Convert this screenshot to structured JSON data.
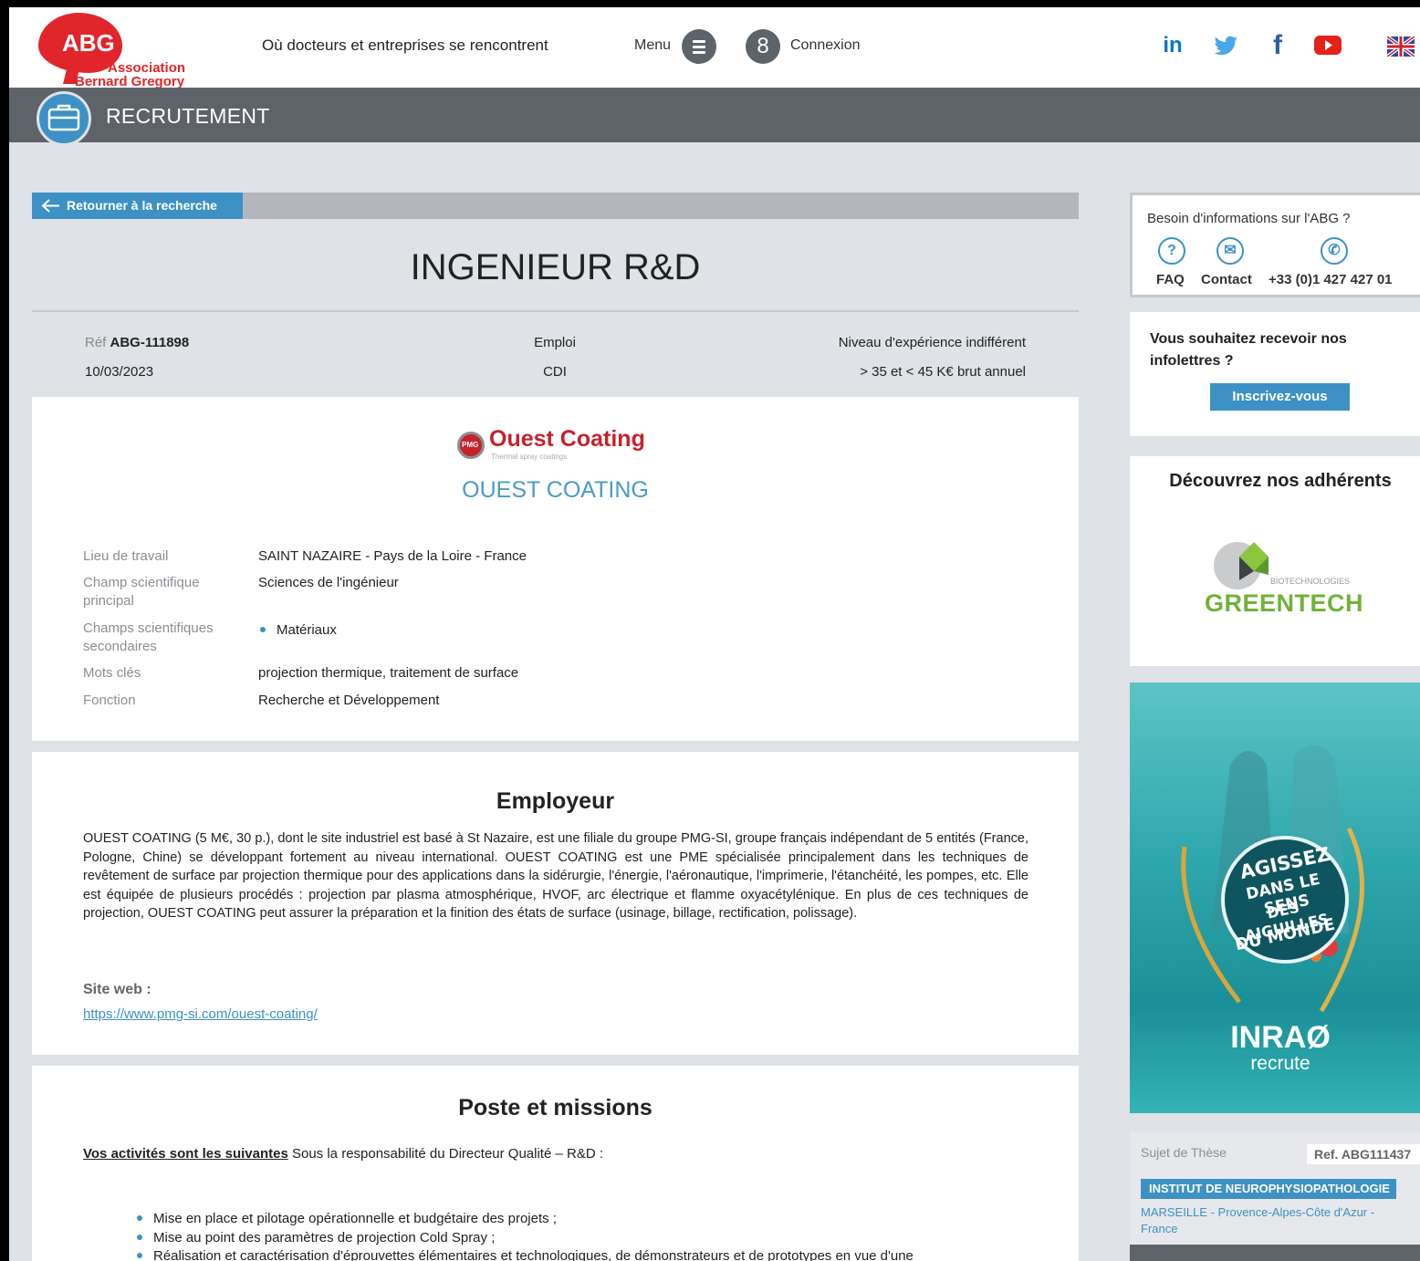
{
  "header": {
    "logo_abg": "ABG",
    "logo_line1": "Association",
    "logo_line2": "Bernard Gregory",
    "tagline": "Où docteurs et entreprises se rencontrent",
    "menu_label": "Menu",
    "connexion_label": "Connexion",
    "social_icons": [
      "linkedin-icon",
      "twitter-icon",
      "facebook-icon",
      "youtube-icon"
    ],
    "language_flag": "uk-flag-icon"
  },
  "section": {
    "title": "RECRUTEMENT",
    "icon": "briefcase-icon"
  },
  "back_button": "Retourner à la recherche",
  "job": {
    "title": "INGENIEUR R&D",
    "ref_prefix": "Réf",
    "ref": "ABG-111898",
    "date": "10/03/2023",
    "type": "Emploi",
    "contract": "CDI",
    "experience": "Niveau d'expérience indifférent",
    "salary": "> 35 et < 45 K€ brut annuel"
  },
  "company": {
    "logo_badge": "PMG",
    "logo_name": "Ouest Coating",
    "logo_sub": "Thermal spray coatings",
    "name": "OUEST COATING",
    "fields": {
      "lieu_label": "Lieu de travail",
      "lieu": "SAINT NAZAIRE - Pays de la Loire - France",
      "champ_label_1": "Champ scientifique",
      "champ_label_2": "principal",
      "champ": "Sciences de l'ingénieur",
      "secondaires_label_1": "Champs scientifiques",
      "secondaires_label_2": "secondaires",
      "secondaires": [
        "Matériaux"
      ],
      "mots_label": "Mots clés",
      "mots": "projection thermique, traitement de surface",
      "fonction_label": "Fonction",
      "fonction": "Recherche et Développement"
    }
  },
  "employer": {
    "heading": "Employeur",
    "text": "OUEST COATING (5 M€, 30 p.), dont le site industriel est basé à St Nazaire, est une filiale du groupe PMG-SI, groupe français indépendant de 5 entités (France, Pologne, Chine) se développant fortement au niveau international. OUEST COATING est une PME spécialisée principalement dans les techniques de revêtement de surface par projection thermique pour des applications dans la sidérurgie, l'énergie, l'aéronautique, l'imprimerie, l'étanchéité, les pompes, etc. Elle est équipée de plusieurs procédés : projection par plasma atmosphérique, HVOF, arc électrique et flamme oxyacétylénique. En plus de ces techniques de projection, OUEST COATING peut assurer la préparation et la finition des états de surface (usinage, billage, rectification, polissage).",
    "site_label": "Site web :",
    "site_url": "https://www.pmg-si.com/ouest-coating/"
  },
  "poste": {
    "heading": "Poste et missions",
    "intro_bold": "Vos activités sont les suivantes",
    "intro_rest": " Sous la responsabilité du Directeur Qualité – R&D :",
    "items": [
      "Mise en place et pilotage opérationnelle et budgétaire des projets ;",
      "Mise au point des paramètres de projection Cold Spray ;",
      "Réalisation et caractérisation d'éprouvettes élémentaires et technologiques, de démonstrateurs et de prototypes en vue d'une"
    ]
  },
  "sidebar": {
    "info_title": "Besoin d'informations sur l'ABG ?",
    "faq": "FAQ",
    "contact": "Contact",
    "phone": "+33 (0)1 427 427 01",
    "newsletter_text": "Vous souhaitez recevoir nos infolettres ?",
    "newsletter_btn": "Inscrivez-vous",
    "members_title": "Découvrez nos adhérents",
    "member_logo_name": "GREENTECH",
    "member_logo_sub": "BIOTECHNOLOGIES",
    "ad_slogan": [
      "AGISSEZ",
      "DANS LE SENS",
      "DES AIGUILLES",
      "DU MONDE"
    ],
    "ad_brand": "INRAØ",
    "ad_sub": "recrute",
    "thesis_label": "Sujet de Thèse",
    "thesis_ref": "Ref. ABG111437",
    "thesis_org": "INSTITUT DE NEUROPHYSIOPATHOLOGIE",
    "thesis_loc": "MARSEILLE - Provence-Alpes-Côte d'Azur - France"
  },
  "colors": {
    "accent": "#3d91c4",
    "brand_red": "#e0262b",
    "bar_gray": "#5e636a",
    "page_bg": "#dfe2e6"
  }
}
